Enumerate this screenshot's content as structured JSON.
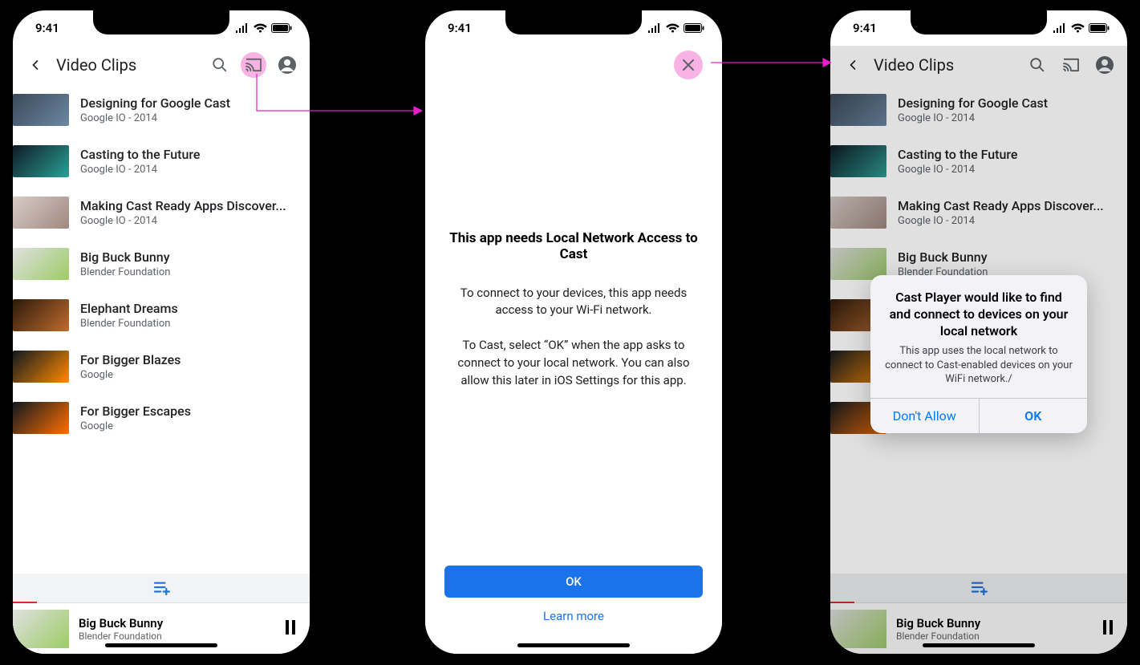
{
  "statusbar": {
    "time": "9:41"
  },
  "header": {
    "title": "Video Clips"
  },
  "videos": [
    {
      "title": "Designing for Google Cast",
      "subtitle": "Google IO - 2014"
    },
    {
      "title": "Casting to the Future",
      "subtitle": "Google IO - 2014"
    },
    {
      "title": "Making Cast Ready Apps Discover...",
      "subtitle": "Google IO - 2014"
    },
    {
      "title": "Big Buck Bunny",
      "subtitle": "Blender Foundation"
    },
    {
      "title": "Elephant Dreams",
      "subtitle": "Blender Foundation"
    },
    {
      "title": "For Bigger Blazes",
      "subtitle": "Google"
    },
    {
      "title": "For Bigger Escapes",
      "subtitle": "Google"
    }
  ],
  "mini_player": {
    "title": "Big Buck Bunny",
    "subtitle": "Blender Foundation"
  },
  "info_screen": {
    "heading": "This app needs Local Network Access to Cast",
    "para1": "To connect to your devices, this app needs access to your Wi-Fi network.",
    "para2": "To Cast, select “OK” when the app asks to connect to your local network. You can also allow this later in iOS Settings for this app.",
    "ok_label": "OK",
    "learn_more_label": "Learn more"
  },
  "ios_alert": {
    "title": "Cast Player would like to find and connect to devices on your local network",
    "message": "This app uses the local network to connect to Cast-enabled devices on your WiFi network./",
    "dont_allow": "Don't Allow",
    "ok": "OK"
  }
}
